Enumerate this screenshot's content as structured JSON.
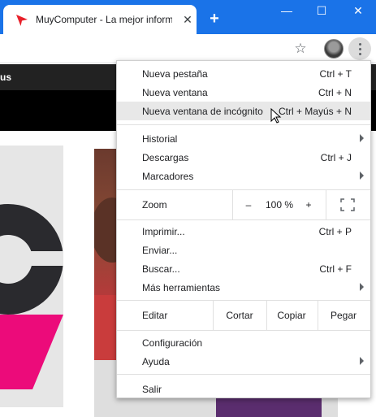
{
  "browser": {
    "tab_title": "MuyComputer - La mejor inform",
    "tab_close": "✕",
    "new_tab": "+",
    "window_controls": {
      "minimize": "—",
      "maximize": "☐",
      "close": "✕"
    },
    "icons": [
      "muycomputer-favicon",
      "star-icon",
      "profile-avatar",
      "three-dot-menu-icon"
    ]
  },
  "site": {
    "nav_text": "us"
  },
  "menu": {
    "group1": [
      {
        "label": "Nueva pestaña",
        "shortcut": "Ctrl + T"
      },
      {
        "label": "Nueva ventana",
        "shortcut": "Ctrl + N"
      },
      {
        "label": "Nueva ventana de incógnito",
        "shortcut": "Ctrl + Mayús + N",
        "hovered": true
      }
    ],
    "group2": [
      {
        "label": "Historial",
        "submenu": true
      },
      {
        "label": "Descargas",
        "shortcut": "Ctrl + J"
      },
      {
        "label": "Marcadores",
        "submenu": true
      }
    ],
    "zoom": {
      "label": "Zoom",
      "minus": "–",
      "value": "100 %",
      "plus": "+"
    },
    "group3": [
      {
        "label": "Imprimir...",
        "shortcut": "Ctrl + P"
      },
      {
        "label": "Enviar..."
      },
      {
        "label": "Buscar...",
        "shortcut": "Ctrl + F"
      },
      {
        "label": "Más herramientas",
        "submenu": true
      }
    ],
    "edit": {
      "label": "Editar",
      "cut": "Cortar",
      "copy": "Copiar",
      "paste": "Pegar"
    },
    "group4": [
      {
        "label": "Configuración"
      },
      {
        "label": "Ayuda",
        "submenu": true
      }
    ],
    "exit": {
      "label": "Salir"
    }
  },
  "colors": {
    "titlebar": "#1a73e8",
    "menu_highlight": "#e8e8e8",
    "favicon": "#e8202a"
  }
}
